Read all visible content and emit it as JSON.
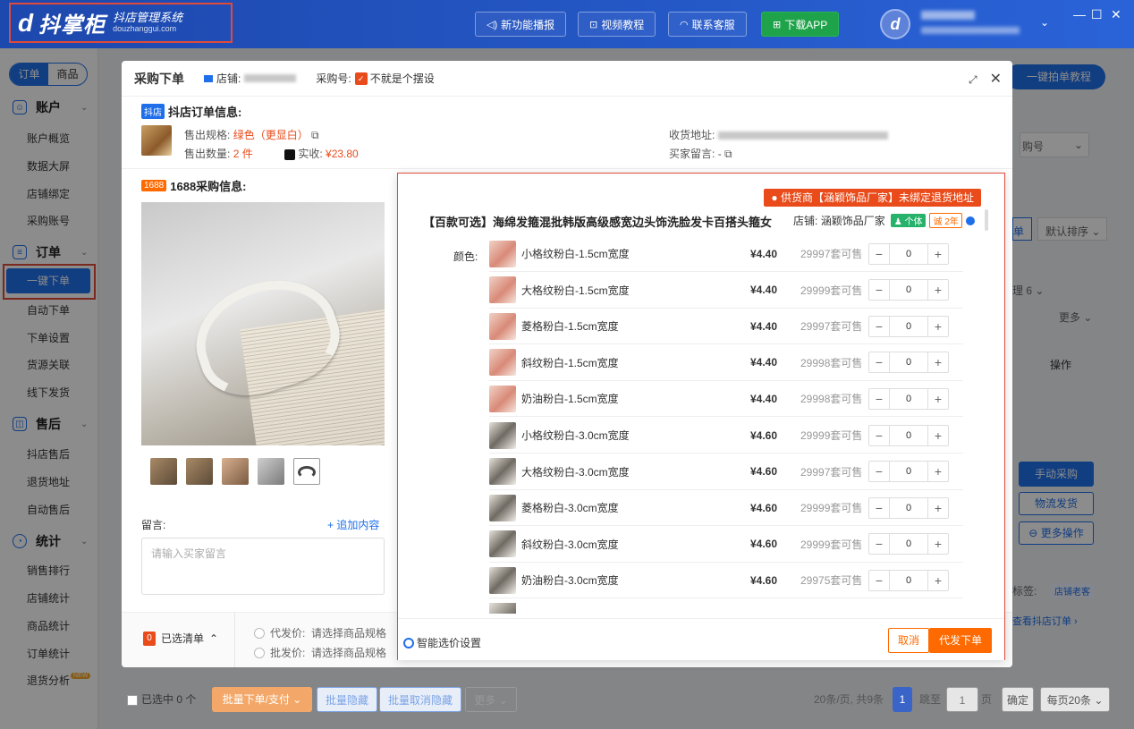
{
  "app": {
    "logo_mark": "d",
    "logo_name": "抖掌柜",
    "logo_sub1": "抖店管理系统",
    "logo_sub2": "douzhanggui.com",
    "top_buttons": [
      "新功能播报",
      "视频教程",
      "联系客服",
      "下载APP"
    ],
    "window_controls": [
      "—",
      "☐",
      "✕"
    ]
  },
  "sidebar": {
    "tabs": [
      "订单",
      "商品"
    ],
    "groups": [
      {
        "label": "账户",
        "items": [
          "账户概览",
          "数据大屏",
          "店铺绑定",
          "采购账号"
        ]
      },
      {
        "label": "订单",
        "items": [
          "一键下单",
          "自动下单",
          "下单设置",
          "货源关联",
          "线下发货"
        ]
      },
      {
        "label": "售后",
        "items": [
          "抖店售后",
          "退货地址",
          "自动售后"
        ]
      },
      {
        "label": "统计",
        "items": [
          "销售排行",
          "店铺统计",
          "商品统计",
          "订单统计",
          "退货分析"
        ]
      }
    ],
    "new_badge": "NEW"
  },
  "background": {
    "tutorial_button": "一键拍单教程",
    "order_no_hint": "购号",
    "sort_default": "默认排序",
    "list_tab": "单",
    "process_label": "理",
    "process_count": "6",
    "more": "更多",
    "operation": "操作",
    "manual_purchase": "手动采购",
    "logistics_ship": "物流发货",
    "more_ops": "更多操作",
    "tag_label": "标签:",
    "tag_value": "店铺老客",
    "view_order": "查看抖店订单"
  },
  "bottombar": {
    "selected": "已选中 0 个",
    "batch_order": "批量下单/支付",
    "batch_hide": "批量隐藏",
    "batch_unhide": "批量取消隐藏",
    "more": "更多",
    "page_info": "20条/页, 共9条",
    "current_page": "1",
    "goto": "跳至",
    "page_input": "1",
    "page_unit": "页",
    "confirm": "确定",
    "per_page": "每页20条"
  },
  "modal": {
    "title": "采购下单",
    "shop_label": "店铺:",
    "purchase_no_label": "采购号:",
    "purchase_no_value": "不就是个摆设",
    "dy_section": {
      "tag": "抖店",
      "title": "抖店订单信息:",
      "spec_label": "售出规格:",
      "spec_value": "绿色（更显白）",
      "qty_label": "售出数量:",
      "qty_value": "2 件",
      "paid_label": "实收:",
      "paid_value": "¥23.80",
      "address_label": "收货地址:",
      "buyer_msg_label": "买家留言:",
      "buyer_msg_value": "-"
    },
    "ali_section": {
      "tag": "1688",
      "title": "1688采购信息:"
    },
    "message": {
      "label": "留言:",
      "add": "+ 追加内容",
      "placeholder": "请输入买家留言"
    },
    "footer": {
      "selected_count": "0",
      "selected_label": "已选清单",
      "dropship_label": "代发价:",
      "dropship_hint": "请选择商品规格",
      "wholesale_label": "批发价:",
      "wholesale_hint": "请选择商品规格"
    }
  },
  "panel": {
    "warning": "供货商【涵颖饰品厂家】未绑定退货地址",
    "product_title": "【百款可选】海绵发箍混批韩版高级感宽边头饰洗脸发卡百搭头箍女",
    "shop_label": "店铺:",
    "shop_name": "涵颖饰品厂家",
    "badge_personal": "个体",
    "badge_years": "2年",
    "color_label": "颜色:",
    "variants": [
      {
        "name": "小格纹粉白-1.5cm宽度",
        "price": "¥4.40",
        "stock": "29997套可售",
        "qty": "0",
        "thumb": "pink"
      },
      {
        "name": "大格纹粉白-1.5cm宽度",
        "price": "¥4.40",
        "stock": "29999套可售",
        "qty": "0",
        "thumb": "pink"
      },
      {
        "name": "菱格粉白-1.5cm宽度",
        "price": "¥4.40",
        "stock": "29997套可售",
        "qty": "0",
        "thumb": "pink"
      },
      {
        "name": "斜纹粉白-1.5cm宽度",
        "price": "¥4.40",
        "stock": "29998套可售",
        "qty": "0",
        "thumb": "pink"
      },
      {
        "name": "奶油粉白-1.5cm宽度",
        "price": "¥4.40",
        "stock": "29998套可售",
        "qty": "0",
        "thumb": "pink"
      },
      {
        "name": "小格纹粉白-3.0cm宽度",
        "price": "¥4.60",
        "stock": "29999套可售",
        "qty": "0",
        "thumb": "grey"
      },
      {
        "name": "大格纹粉白-3.0cm宽度",
        "price": "¥4.60",
        "stock": "29997套可售",
        "qty": "0",
        "thumb": "grey"
      },
      {
        "name": "菱格粉白-3.0cm宽度",
        "price": "¥4.60",
        "stock": "29999套可售",
        "qty": "0",
        "thumb": "grey"
      },
      {
        "name": "斜纹粉白-3.0cm宽度",
        "price": "¥4.60",
        "stock": "29999套可售",
        "qty": "0",
        "thumb": "grey"
      },
      {
        "name": "奶油粉白-3.0cm宽度",
        "price": "¥4.60",
        "stock": "29975套可售",
        "qty": "0",
        "thumb": "grey"
      }
    ],
    "smart_pick": "智能选价设置",
    "cancel": "取消",
    "submit": "代发下单"
  }
}
